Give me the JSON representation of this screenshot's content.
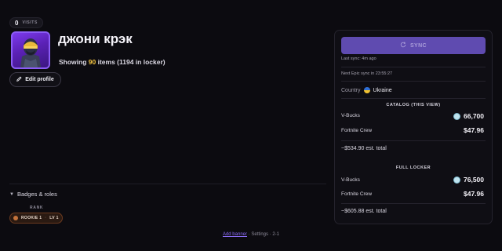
{
  "profile": {
    "visits_count": "0",
    "visits_label": "VISITS",
    "username": "джони крэк",
    "showing_prefix": "Showing ",
    "showing_count": "90",
    "showing_suffix": " items (1194 in locker)",
    "edit_label": "Edit profile"
  },
  "badges": {
    "heading": "Badges & roles",
    "rank_label": "RANK",
    "rank_name": "ROOKIE 1",
    "rank_level": "LV 1"
  },
  "footer": {
    "link": "Add banner",
    "text": " · Settings · 2-1"
  },
  "panel": {
    "sync_label": "SYNC",
    "last_sync": "Last sync: 4m ago",
    "next_sync": "Next Epic sync in 23:55:27",
    "country_label": "Country",
    "country_value": "Ukraine",
    "catalog": {
      "title": "CATALOG (THIS VIEW)",
      "vbucks_label": "V-Bucks",
      "vbucks_value": "66,700",
      "crew_label": "Fortnite Crew",
      "crew_value": "$47.96",
      "total": "~$534.90 est. total"
    },
    "locker": {
      "title": "FULL LOCKER",
      "vbucks_label": "V-Bucks",
      "vbucks_value": "76,500",
      "crew_label": "Fortnite Crew",
      "crew_value": "$47.96",
      "total": "~$605.88 est. total"
    }
  },
  "colors": {
    "accent": "#8b5cf6",
    "highlight": "#f5c542",
    "sync_button": "#5f4bb0"
  },
  "icons": {
    "sync": "refresh-icon",
    "edit": "pencil-icon",
    "vbucks": "vbucks-icon",
    "flag": "ukraine-flag-icon"
  }
}
